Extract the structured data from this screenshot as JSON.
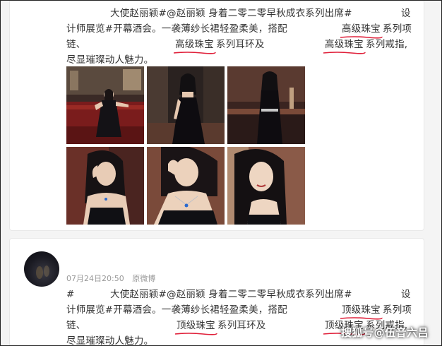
{
  "post1": {
    "line1_left": "大使赵丽颖#@赵丽颖 身着二零二零早秋成衣系列出席#",
    "line1_right": "设",
    "line2_a": "计师展览#开幕酒会。一袭薄纱长裙轻盈柔美，搭配",
    "line2_hl": "高级珠宝",
    "line2_b": "系列项",
    "line3_a": "链、",
    "line3_hl1": "高级珠宝",
    "line3_b": "系列耳环及",
    "line3_hl2": "高级珠宝",
    "line3_c": "系列戒指,",
    "line4": "尽显璀璨动人魅力。",
    "photos": [
      {
        "icon": "photo-lounge-red-sofa"
      },
      {
        "icon": "photo-standing-dark-room"
      },
      {
        "icon": "photo-bar-counter"
      },
      {
        "icon": "photo-portrait-red-wall"
      },
      {
        "icon": "photo-closeup-hand-face"
      },
      {
        "icon": "photo-closeup-smile"
      }
    ]
  },
  "post2": {
    "date": "07月24日20:50",
    "source": "原微博",
    "line1_a": "#",
    "line1_b": "大使赵丽颖#@赵丽颖 身着二零二零早秋成衣系列出席#",
    "line1_right": "设",
    "line2_a": "计师展览#开幕酒会。一袭薄纱长裙轻盈柔美，搭配",
    "line2_hl": "顶级珠宝",
    "line2_b": "系列项",
    "line3_a": "链、",
    "line3_hl1": "顶级珠宝",
    "line3_b": "系列耳环及",
    "line3_hl2": "顶级珠宝",
    "line3_c": "系列戒指,",
    "line4": "尽显璀璨动人魅力。"
  },
  "watermark": "搜狐号@伍音六吕",
  "colors": {
    "underline": "#e0203a",
    "text": "#333333",
    "meta": "#999999"
  }
}
